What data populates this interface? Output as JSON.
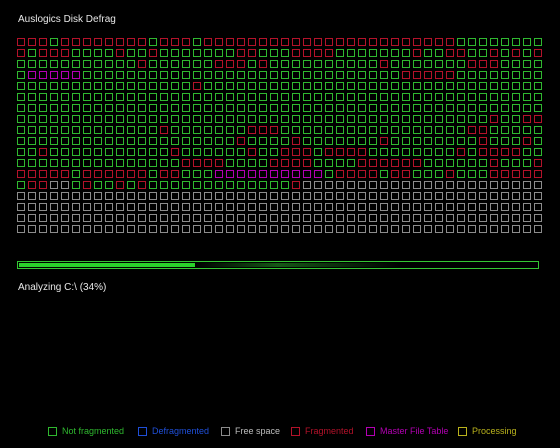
{
  "app": {
    "title": "Auslogics Disk Defrag"
  },
  "status": {
    "text": "Analyzing C:\\ (34%)",
    "progress_fraction": 0.34
  },
  "colors": {
    "not_fragmented": "#2fb82f",
    "defragmented": "#1f4fd8",
    "free_space": "#8c8c8c",
    "fragmented": "#b3122a",
    "master_file_table": "#b300b3",
    "processing": "#b9b21c",
    "progress": "#2bd22b"
  },
  "legend": [
    {
      "label": "Not fragmented",
      "color": "#2fb82f",
      "text_color": "#2fb82f"
    },
    {
      "label": "Defragmented",
      "color": "#1f4fd8",
      "text_color": "#1f4fd8"
    },
    {
      "label": "Free space",
      "color": "#8c8c8c",
      "text_color": "#bdbdbd"
    },
    {
      "label": "Fragmented",
      "color": "#b3122a",
      "text_color": "#b3122a"
    },
    {
      "label": "Master File Table",
      "color": "#b300b3",
      "text_color": "#b300b3"
    },
    {
      "label": "Processing",
      "color": "#b9b21c",
      "text_color": "#b9b21c"
    }
  ],
  "cluster_map": [
    "RRRGRRRRRRRRGRRRGRRRRRRRRRRRRRRRRRRRRRRRGGGGGGGG",
    "RGRRRGGGGRGGRGGGGGGGRRGGGRRRRGGGGGGGRGGRRGGRGRGR",
    "GGGGGGGGGGGRGGGGGGRRRGRGGGGGGGGGGRGGGGGGGRRRGGGG",
    "GMMMMMGGGGGGGGGGGGGGGGGGGGGGGGGGGGGRRRRRGGGGGGGG",
    "GGGGGGGGGGGGGGGGRGGGGGGGGGGGGGGGGGGGGGGGGGGGGGGG",
    "GGGGGGGGGGGGGGGGGGGGGGGGGGGGGGGGGGGGGGGGGGGGGGGG",
    "GGGGGGGGGGGGGGGGGGGGGGGGGGGGGGGGGGGGGGGGGGGGGGGG",
    "GGGGGGGGGGGGGGGGGGGGGGGGGGGGGGGGGGGGGGGGGGGRGGRR",
    "GGGGGGGGGGGGGRGGGGGGGRRRGGGGGGGGGGGGGGGGGRRGGGGG",
    "GGGGGGGGGGGGGGGGGGGGRGGGGRGGGGGGGRGGGGGGGGRGGGRG",
    "GGRGGGGGGGGGGGRGGGGGGRGGRRRGRRRRGGGGGGGGRGRRRRGG",
    "GGGGGGGGGGGGGGGRRRRGGGGRRRRGGGGRRRRRRGGGGGGRGGGR",
    "RRRRRGRRRRRRGRRGGGMMMMMMMMMMGRRRRGRRGGGRGGGRRRRR",
    "GRRWWGRGGRGRGGGGGGGGGGGGGRWWWWWWWWWWWWWWWWWWWWWW",
    "WWWWWWWWWWWWWWWWWWWWWWWWWWWWWWWWWWWWWWWWWWWWWWWW",
    "WWWWWWWWWWWWWWWWWWWWWWWWWWWWWWWWWWWWWWWWWWWWWWWW",
    "WWWWWWWWWWWWWWWWWWWWWWWWWWWWWWWWWWWWWWWWWWWWWWWW",
    "WWWWWWWWWWWWWWWWWWWWWWWWWWWWWWWWWWWWWWWWWWWWWWWW"
  ]
}
